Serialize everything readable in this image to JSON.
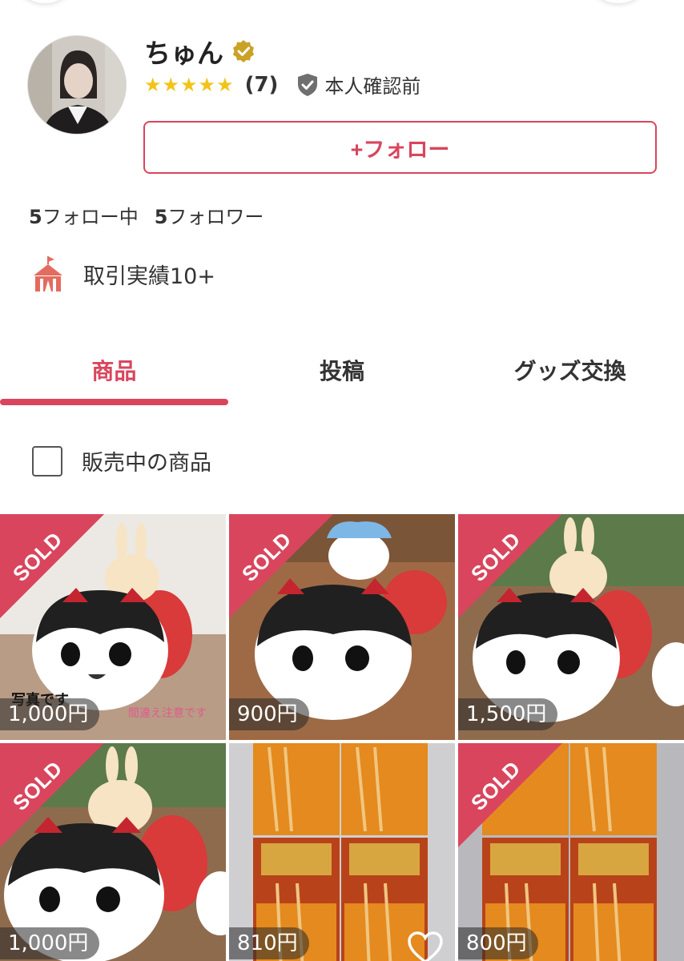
{
  "profile": {
    "username": "ちゅん",
    "rating_stars": 5,
    "rating_count": "(7)",
    "id_status": "本人確認前",
    "follow_label": "+フォロー",
    "following_num": "5",
    "following_label": "フォロー中",
    "followers_num": "5",
    "followers_label": "フォロワー",
    "achievement": "取引実績10+"
  },
  "tabs": [
    "商品",
    "投稿",
    "グッズ交換"
  ],
  "active_tab": 0,
  "filter": {
    "label": "販売中の商品",
    "checked": false
  },
  "products": [
    {
      "price": "1,000円",
      "sold": true,
      "overlay_text": "写真です",
      "overlay_pink": "間違え注意です"
    },
    {
      "price": "900円",
      "sold": true
    },
    {
      "price": "1,500円",
      "sold": true
    },
    {
      "price": "1,000円",
      "sold": true
    },
    {
      "price": "810円",
      "sold": false,
      "liked": false
    },
    {
      "price": "800円",
      "sold": true
    }
  ],
  "sold_label": "SOLD",
  "colors": {
    "accent": "#d9455d",
    "star": "#f2c418",
    "verified": "#c9a227"
  }
}
